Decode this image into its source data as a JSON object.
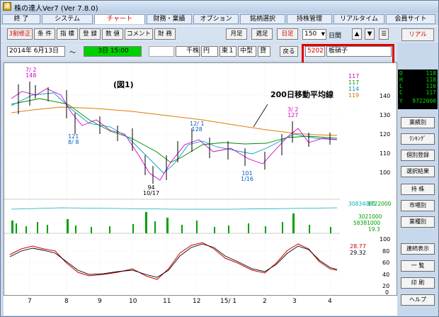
{
  "window": {
    "title": "株の達人Ver7 (Ver 7.8.0)"
  },
  "menu": [
    "終 了",
    "システム",
    "チャート",
    "財務・業績",
    "オプション",
    "銘柄選択",
    "持株管理",
    "リアルタイム",
    "会員サイト"
  ],
  "toolbar1": {
    "left": [
      "3割修正",
      "条 件",
      "指 標",
      "登 録",
      "数 値",
      "コメント",
      "財 務"
    ],
    "right": [
      "月足",
      "週足",
      "日足"
    ],
    "count": "150",
    "count_unit": "日間",
    "nav": [
      "▲",
      "▼",
      "☰"
    ],
    "real": "リアル"
  },
  "toolbar2": {
    "date": "2014年 6月13日",
    "tilde": "〜",
    "range": "3日 15:00",
    "unit_value": "千株",
    "currency": "円",
    "market": "東１",
    "size": "中型",
    "lot": "貸",
    "back": "戻る",
    "stock_code": "5202",
    "stock_name": "板硝子"
  },
  "ohlc": {
    "O": "118",
    "H": "118",
    "L": "116",
    "C": "117",
    "V": "9722000",
    "Y": "Y"
  },
  "chart": {
    "label_fig": "(図1)",
    "annotation": "200日移動平均線",
    "ma_values": [
      "117",
      "117",
      "114",
      "119"
    ],
    "price_ticks": [
      "140",
      "130",
      "120",
      "110",
      "100"
    ],
    "callouts": [
      {
        "id": "high1",
        "lines": [
          "7/ 2",
          "148"
        ]
      },
      {
        "id": "low1",
        "lines": [
          "121",
          "8/ 8"
        ]
      },
      {
        "id": "low2",
        "lines": [
          "94",
          "10/17"
        ]
      },
      {
        "id": "mid1",
        "lines": [
          "12/ 1",
          "128"
        ]
      },
      {
        "id": "low3",
        "lines": [
          "101",
          "1/16"
        ]
      },
      {
        "id": "high2",
        "lines": [
          "3/ 2",
          "127"
        ]
      }
    ],
    "volume_labels": [
      "30834000",
      "9722000",
      "3021000",
      "58381000",
      "19.3"
    ],
    "osc_values": [
      "28.77",
      "29.32"
    ],
    "osc_ticks": [
      "100",
      "80",
      "60",
      "40",
      "20",
      "0"
    ],
    "x_labels": [
      "7",
      "8",
      "9",
      "10",
      "11",
      "12",
      "15/ 1",
      "2",
      "3",
      "4"
    ]
  },
  "sidebar": [
    "業績別",
    "ﾗﾝｷﾝｸﾞ",
    "個別登録",
    "選択結果",
    "持 株",
    "市場別",
    "業種別",
    "連続表示",
    "一 覧",
    "印 刷",
    "ヘルプ"
  ]
}
